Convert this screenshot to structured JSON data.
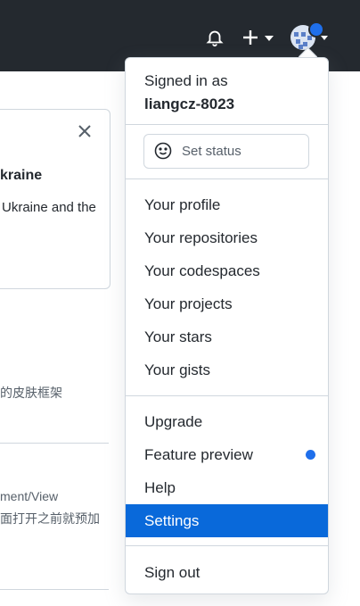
{
  "background": {
    "card_heading": "kraine",
    "card_body": "Ukraine and the",
    "item_1": "的皮肤框架",
    "item_2a": "ment/View",
    "item_2b": "面打开之前就预加"
  },
  "account_menu": {
    "signed_in_as": "Signed in as",
    "username": "liangcz-8023",
    "set_status": "Set status",
    "items_group1": [
      "Your profile",
      "Your repositories",
      "Your codespaces",
      "Your projects",
      "Your stars",
      "Your gists"
    ],
    "items_group2": [
      "Upgrade",
      "Feature preview",
      "Help",
      "Settings"
    ],
    "sign_out": "Sign out",
    "active_item": "Settings"
  },
  "colors": {
    "header_bg": "#24292f",
    "accent": "#0969da",
    "notification_dot": "#1f6feb"
  },
  "icons": [
    "bell-icon",
    "plus-icon",
    "caret-down-icon",
    "avatar",
    "close-icon",
    "smiley-icon"
  ]
}
